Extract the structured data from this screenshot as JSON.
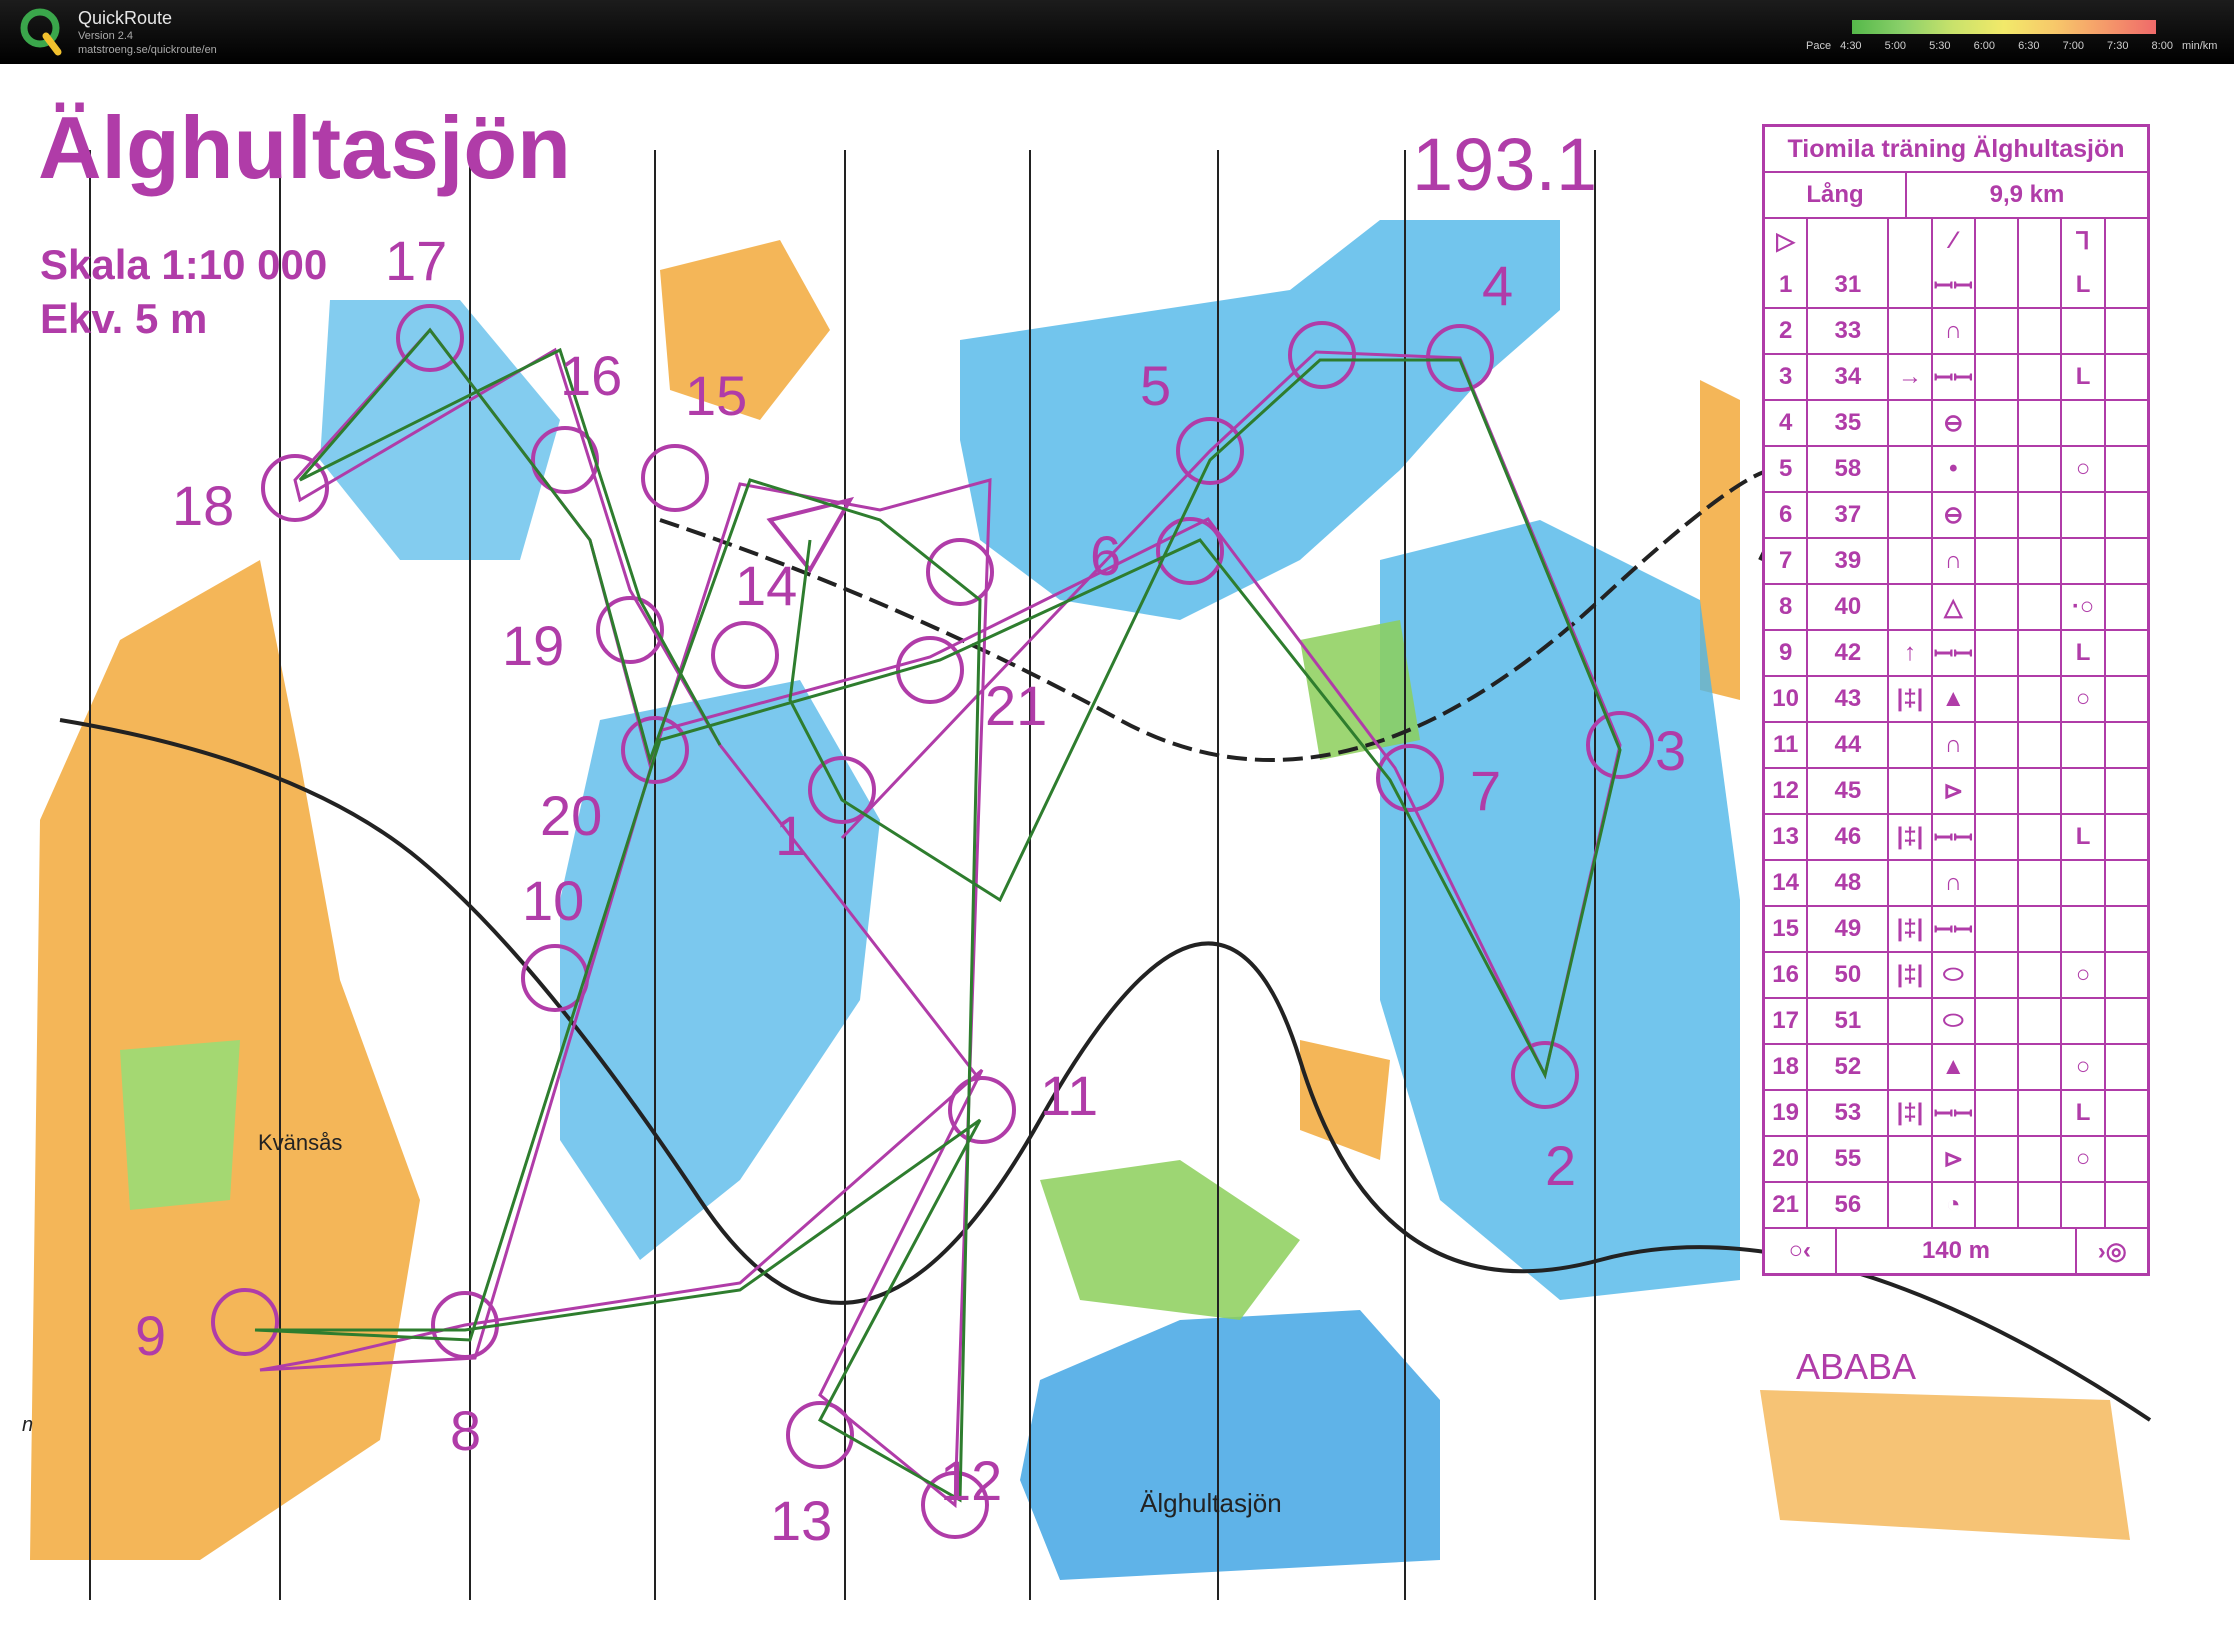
{
  "app": {
    "name": "QuickRoute",
    "version": "Version 2.4",
    "url": "matstroeng.se/quickroute/en"
  },
  "pace_legend": {
    "label": "Pace",
    "ticks": [
      "4:30",
      "5:00",
      "5:30",
      "6:00",
      "6:30",
      "7:00",
      "7:30",
      "8:00"
    ],
    "unit": "min/km"
  },
  "map": {
    "title": "Älghultasjön",
    "scale": "Skala 1:10 000",
    "contour": "Ekv. 5 m",
    "course_code": "193.1",
    "place_kvansas": "Kvänsås",
    "place_lake": "Älghultasjön",
    "place_ababa": "ABABA",
    "corner_letter": "n",
    "colors": {
      "course": "#b03ca8",
      "route": "#2e7d2e",
      "water": "#4fb6e8",
      "open": "#f2a93b",
      "forest": "#ffffff",
      "green": "#8ccf5a"
    }
  },
  "description": {
    "title": "Tiomila träning Älghultasjön",
    "class": "Lång",
    "length": "9,9 km",
    "finish_distance": "140 m",
    "controls": [
      {
        "n": "1",
        "code": "31",
        "dir": "",
        "feat": "ꟷꟷ",
        "extra": "L"
      },
      {
        "n": "2",
        "code": "33",
        "dir": "",
        "feat": "∩",
        "extra": ""
      },
      {
        "n": "3",
        "code": "34",
        "dir": "→",
        "feat": "ꟷꟷ",
        "extra": "L"
      },
      {
        "n": "4",
        "code": "35",
        "dir": "",
        "feat": "⊖",
        "extra": ""
      },
      {
        "n": "5",
        "code": "58",
        "dir": "",
        "feat": "•",
        "extra": "○"
      },
      {
        "n": "6",
        "code": "37",
        "dir": "",
        "feat": "⊖",
        "extra": ""
      },
      {
        "n": "7",
        "code": "39",
        "dir": "",
        "feat": "∩",
        "extra": ""
      },
      {
        "n": "8",
        "code": "40",
        "dir": "",
        "feat": "△",
        "extra": "·○"
      },
      {
        "n": "9",
        "code": "42",
        "dir": "↑",
        "feat": "ꟷꟷ",
        "extra": "L"
      },
      {
        "n": "10",
        "code": "43",
        "dir": "|‡|",
        "feat": "▲",
        "extra": "○"
      },
      {
        "n": "11",
        "code": "44",
        "dir": "",
        "feat": "∩",
        "extra": ""
      },
      {
        "n": "12",
        "code": "45",
        "dir": "",
        "feat": "⊳",
        "extra": ""
      },
      {
        "n": "13",
        "code": "46",
        "dir": "|‡|",
        "feat": "ꟷꟷ",
        "extra": "L"
      },
      {
        "n": "14",
        "code": "48",
        "dir": "",
        "feat": "∩",
        "extra": ""
      },
      {
        "n": "15",
        "code": "49",
        "dir": "|‡|",
        "feat": "ꟷꟷ",
        "extra": ""
      },
      {
        "n": "16",
        "code": "50",
        "dir": "|‡|",
        "feat": "⬭",
        "extra": "○"
      },
      {
        "n": "17",
        "code": "51",
        "dir": "",
        "feat": "⬭",
        "extra": ""
      },
      {
        "n": "18",
        "code": "52",
        "dir": "",
        "feat": "▲",
        "extra": "○"
      },
      {
        "n": "19",
        "code": "53",
        "dir": "|‡|",
        "feat": "ꟷꟷ",
        "extra": "L"
      },
      {
        "n": "20",
        "code": "55",
        "dir": "",
        "feat": "⊳",
        "extra": "○"
      },
      {
        "n": "21",
        "code": "56",
        "dir": "",
        "feat": "◔",
        "extra": ""
      }
    ]
  }
}
